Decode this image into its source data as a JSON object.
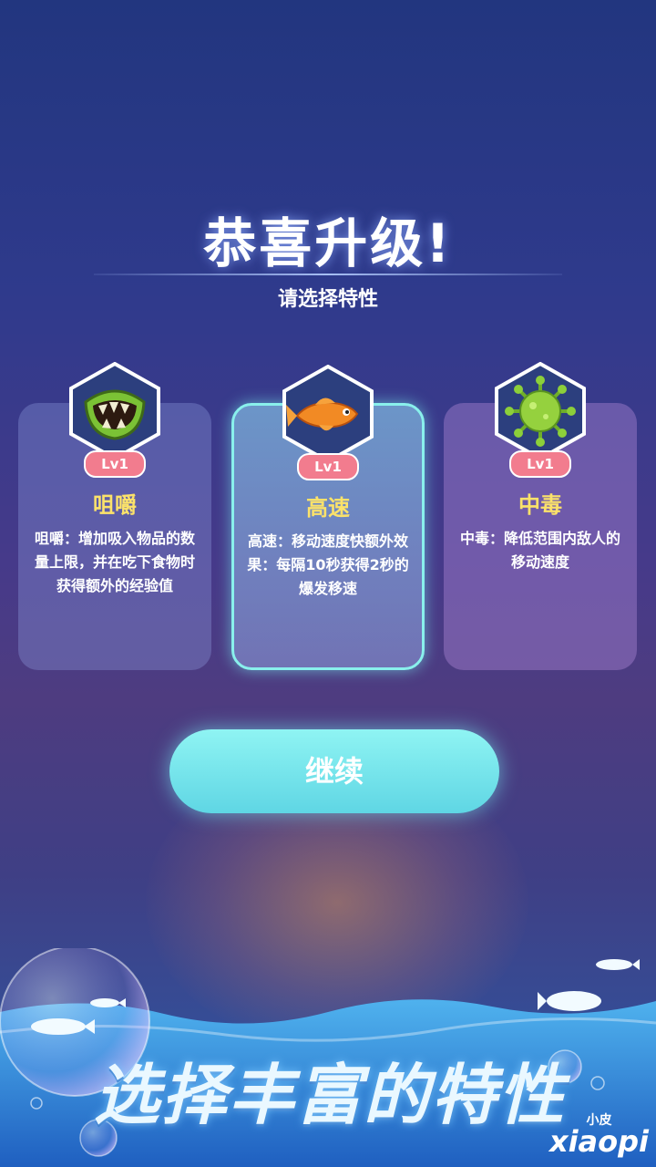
{
  "header": {
    "title": "恭喜升级!",
    "subtitle": "请选择特性"
  },
  "cards": [
    {
      "name": "咀嚼",
      "level": "Lv1",
      "description": "咀嚼：增加吸入物品的数量上限，并在吃下食物时获得额外的经验值",
      "icon": "chomping-mouth-icon",
      "selected": false
    },
    {
      "name": "高速",
      "level": "Lv1",
      "description": "高速：移动速度快额外效果：每隔10秒获得2秒的爆发移速",
      "icon": "orange-fish-icon",
      "selected": true
    },
    {
      "name": "中毒",
      "level": "Lv1",
      "description": "中毒：降低范围内敌人的移动速度",
      "icon": "green-virus-icon",
      "selected": false
    }
  ],
  "actions": {
    "continue_label": "继续"
  },
  "banner": {
    "text": "选择丰富的特性"
  },
  "watermark": {
    "small": "小皮",
    "large": "xiaopi"
  },
  "colors": {
    "accent_cyan": "#89f0ec",
    "level_badge": "#f27c8e",
    "card_title": "#fbe26a"
  }
}
